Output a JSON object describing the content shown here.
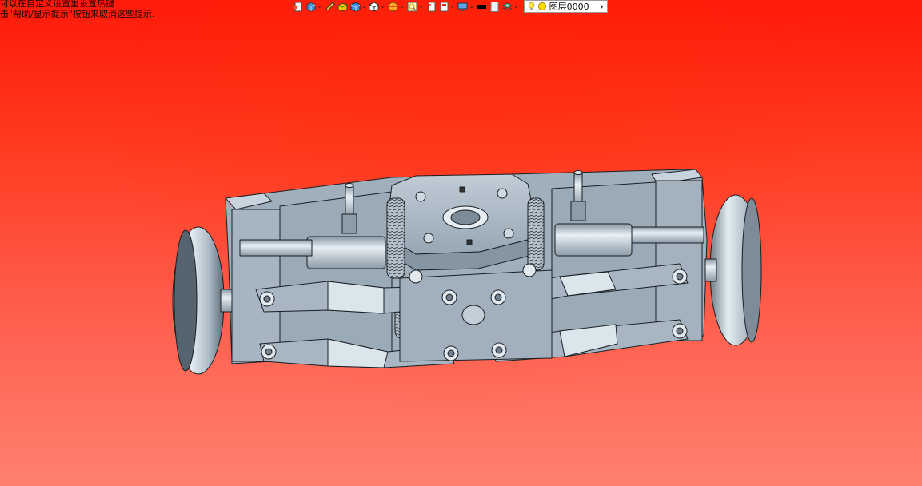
{
  "hints": {
    "line1": "可以在自定义设置里设置热键",
    "line2": "击\"帮助/显示提示\"按钮来取消这些提示."
  },
  "toolbar": {
    "layer_selector": {
      "value": "图层0000"
    },
    "dropdown_arrow": "⌄",
    "select_arrow": "▾"
  },
  "colors": {
    "background_top": "#ff1a0a",
    "background_bottom": "#ff8070",
    "part_face": "#a9b8c4",
    "part_light": "#d6e1ea",
    "part_dark": "#6f7f8c",
    "edge": "#1b1f24"
  },
  "icons": [
    "layout-icon",
    "shaded-view-icon",
    "pencil-icon",
    "box-material-icon",
    "solid-box-icon",
    "wire-cube-icon",
    "render-sphere-icon",
    "zoom-icon",
    "rotate-icon",
    "fit-view-icon",
    "monitor-icon",
    "black-square-icon",
    "white-rect-icon",
    "layer-stack-icon",
    "bulb-icon",
    "light-circle-icon"
  ]
}
